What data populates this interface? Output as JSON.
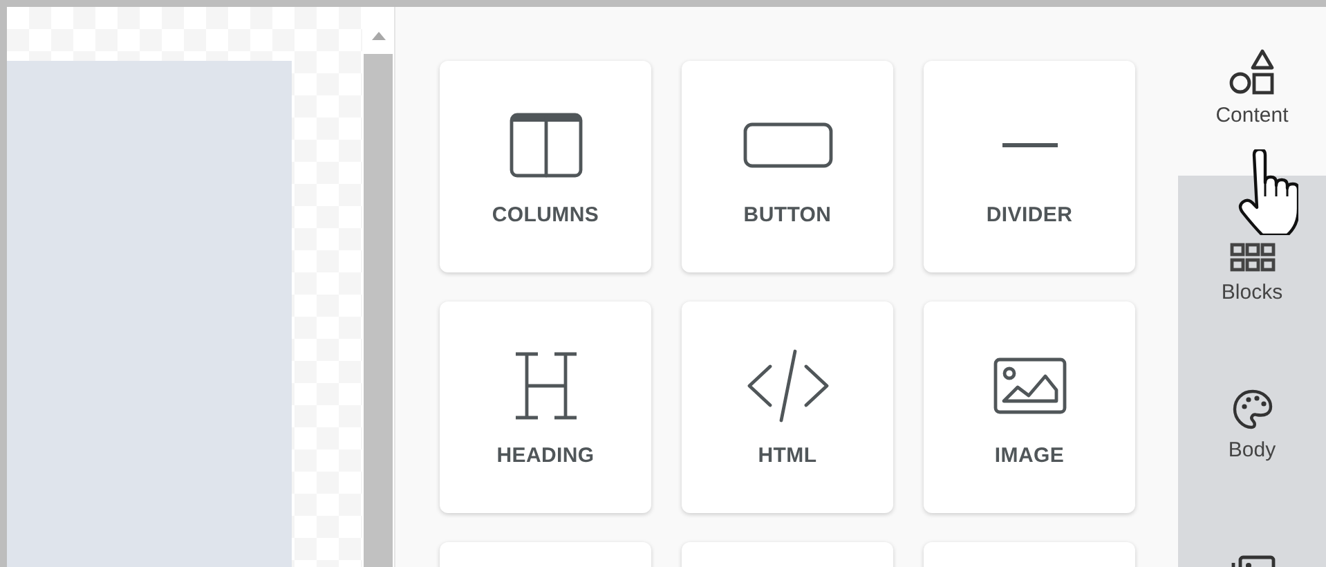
{
  "tiles": [
    {
      "kind": "columns",
      "label": "COLUMNS"
    },
    {
      "kind": "button",
      "label": "BUTTON"
    },
    {
      "kind": "divider",
      "label": "DIVIDER"
    },
    {
      "kind": "heading",
      "label": "HEADING"
    },
    {
      "kind": "html",
      "label": "HTML"
    },
    {
      "kind": "image",
      "label": "IMAGE"
    },
    {
      "kind": "cut"
    },
    {
      "kind": "cut"
    },
    {
      "kind": "cut"
    }
  ],
  "tabs": [
    {
      "kind": "shapes",
      "label": "Content",
      "selected": true
    },
    {
      "kind": "grid",
      "label": "Blocks",
      "selected": false
    },
    {
      "kind": "palette",
      "label": "Body",
      "selected": false
    },
    {
      "kind": "image",
      "selected": false
    }
  ]
}
